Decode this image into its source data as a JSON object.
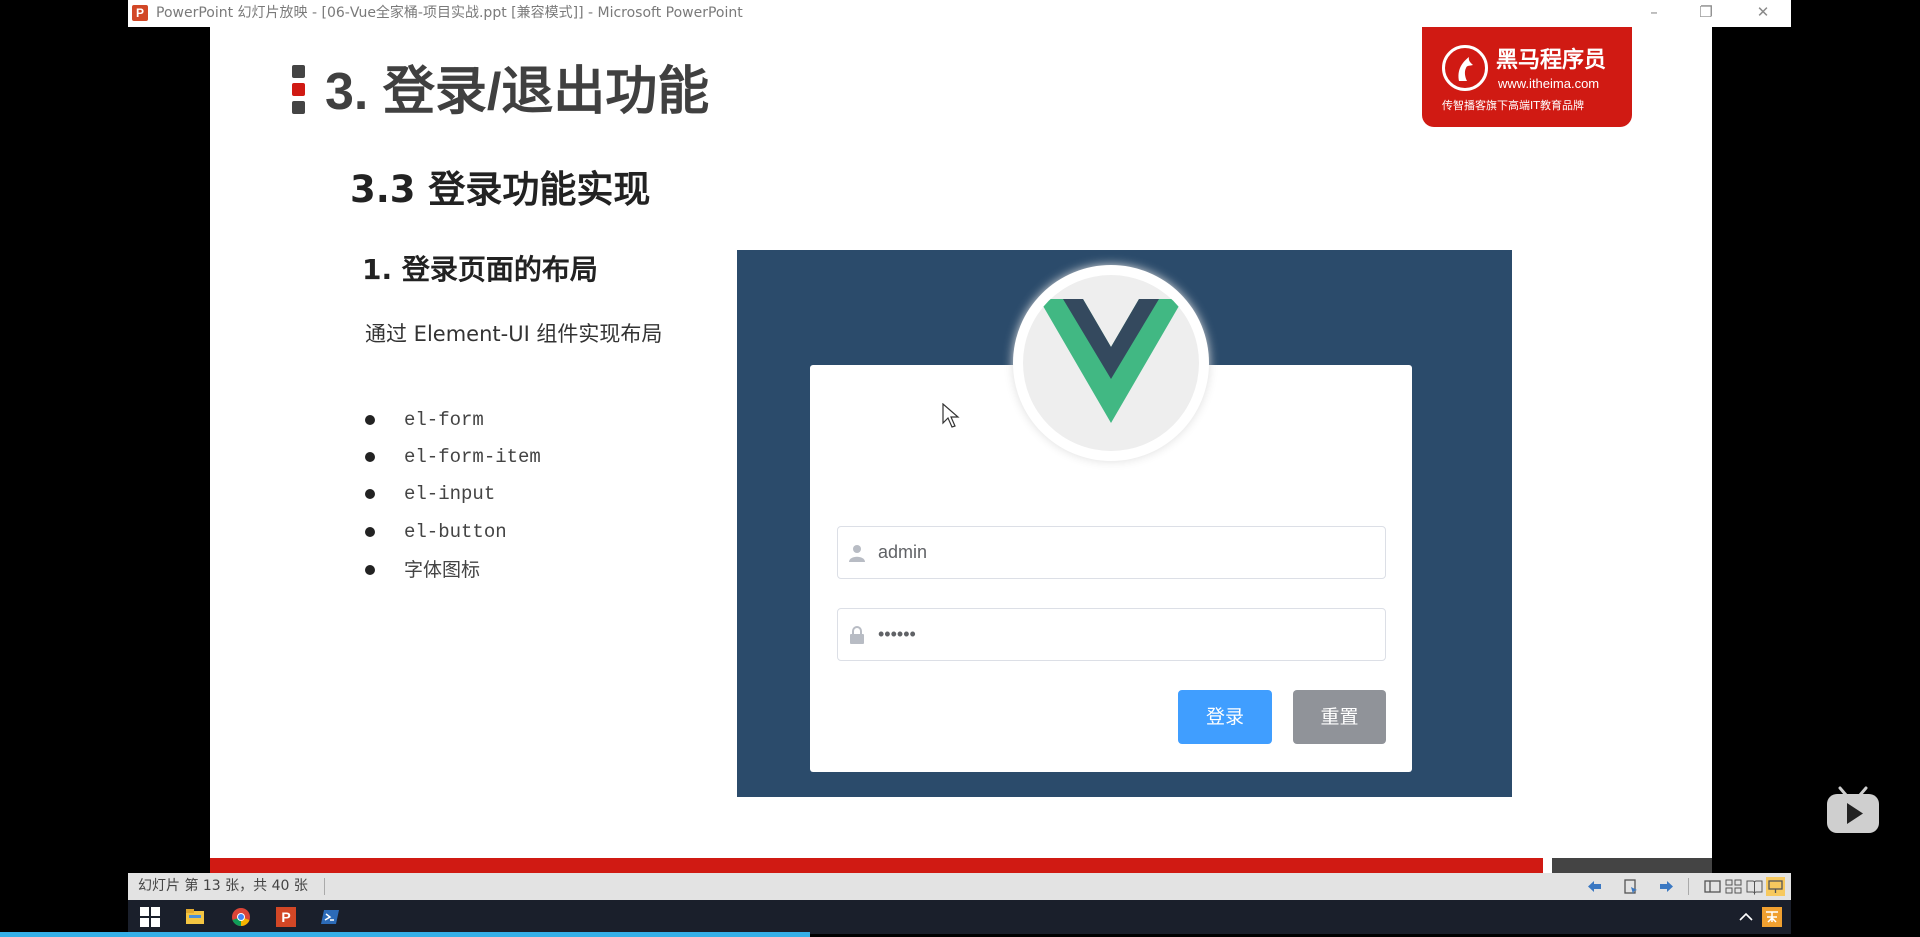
{
  "window": {
    "icon_letter": "P",
    "title": "PowerPoint 幻灯片放映 - [06-Vue全家桶-项目实战.ppt [兼容模式]] - Microsoft PowerPoint"
  },
  "slide": {
    "title": "3. 登录/退出功能",
    "logo": {
      "name": "黑马程序员",
      "url": "www.itheima.com",
      "slogan": "传智播客旗下高端IT教育品牌"
    },
    "subtitle": "3.3 登录功能实现",
    "section_heading": "1. 登录页面的布局",
    "description": "通过 Element-UI 组件实现布局",
    "bullets": [
      "el-form",
      "el-form-item",
      "el-input",
      "el-button",
      "字体图标"
    ],
    "login_form": {
      "username_value": "admin",
      "password_value": "••••••",
      "login_label": "登录",
      "reset_label": "重置"
    }
  },
  "statusbar": {
    "slide_info": "幻灯片 第 13 张，共 40 张"
  },
  "colors": {
    "accent_red": "#d01a13",
    "login_bg": "#2b4b6b",
    "primary_button": "#409eff",
    "info_button": "#909399",
    "vue_green": "#41b883",
    "vue_dark": "#34495e"
  }
}
